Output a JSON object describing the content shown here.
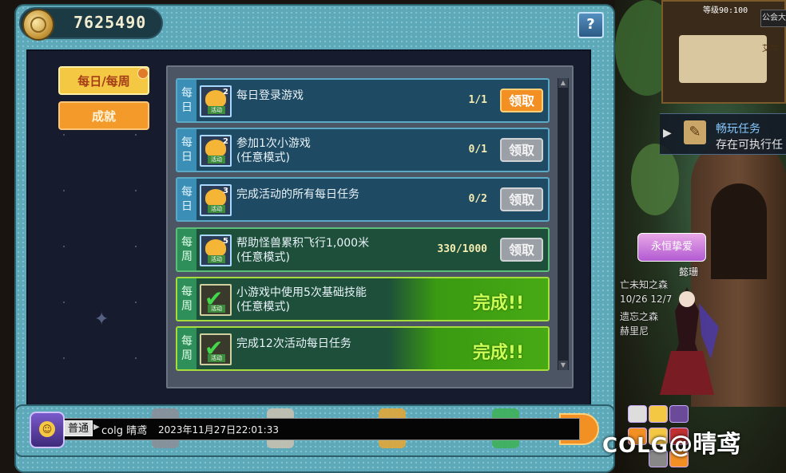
{
  "currency": {
    "icon": "coin-icon",
    "value": "7625490"
  },
  "help_label": "?",
  "categories": [
    {
      "label": "每日/每周",
      "selected": true
    },
    {
      "label": "成就",
      "selected": false
    }
  ],
  "tasks": [
    {
      "period": "每日",
      "icon_num": "2",
      "icon_tag": "活动",
      "name_line1": "每日登录游戏",
      "name_line2": "",
      "progress": "1/1",
      "action": "领取",
      "state": "claimable"
    },
    {
      "period": "每日",
      "icon_num": "2",
      "icon_tag": "活动",
      "name_line1": "参加1次小游戏",
      "name_line2": "(任意模式)",
      "progress": "0/1",
      "action": "领取",
      "state": "disabled"
    },
    {
      "period": "每日",
      "icon_num": "3",
      "icon_tag": "活动",
      "name_line1": "完成活动的所有每日任务",
      "name_line2": "",
      "progress": "0/2",
      "action": "领取",
      "state": "disabled"
    },
    {
      "period": "每周",
      "icon_num": "5",
      "icon_tag": "活动",
      "name_line1": "帮助怪兽累积飞行1,000米",
      "name_line2": "(任意模式)",
      "progress": "330/1000",
      "action": "领取",
      "state": "disabled"
    },
    {
      "period": "每周",
      "icon_num": "",
      "icon_tag": "活动",
      "name_line1": "小游戏中使用5次基础技能",
      "name_line2": "(任意模式)",
      "progress": "",
      "action": "完成!!",
      "state": "complete"
    },
    {
      "period": "每周",
      "icon_num": "",
      "icon_tag": "活动",
      "name_line1": "完成12次活动每日任务",
      "name_line2": "",
      "progress": "",
      "action": "完成!!",
      "state": "complete"
    }
  ],
  "chat": {
    "channel": "普通",
    "sender": "colg 晴鸢",
    "timestamp": "2023年11月27日22:01:33"
  },
  "scene": {
    "level": "等级90:100",
    "guild": "公会大",
    "place": "艾尔",
    "quest_tip_title": "畅玩任务",
    "quest_tip_text": "存在可执行任",
    "title_badge": "永恒挚爱",
    "char_name": "懿珊",
    "side_lines": [
      "亡未知之森",
      "10/26 12/7",
      "遗忘之森",
      "赫里尼"
    ]
  },
  "watermark": {
    "logo": "COLG",
    "text": "@晴鸢"
  },
  "colors": {
    "daily_border": "#5ba9c7",
    "weekly_border": "#5cbf7a",
    "claim_active": "#f39024",
    "claim_disabled": "#9aa0a6",
    "complete_text": "#ccff55"
  }
}
